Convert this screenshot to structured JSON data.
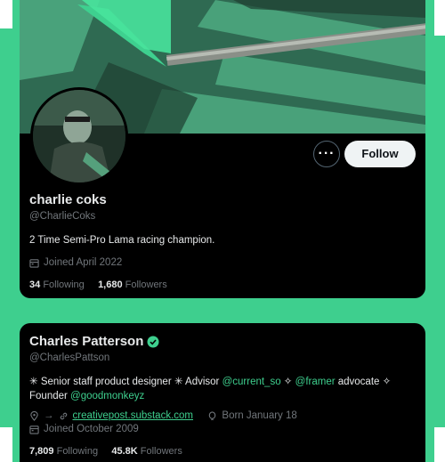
{
  "colors": {
    "accent": "#3ecf8e",
    "card_bg": "#000000",
    "muted": "#71767b",
    "text": "#e7e9ea"
  },
  "profile1": {
    "name": "charlie coks",
    "handle": "@CharlieCoks",
    "bio": "2 Time Semi-Pro Lama racing champion.",
    "joined": "Joined April 2022",
    "following_count": "34",
    "following_label": "Following",
    "followers_count": "1,680",
    "followers_label": "Followers",
    "more_label": "···",
    "follow_label": "Follow"
  },
  "profile2": {
    "name": "Charles Patterson",
    "handle": "@CharlesPattson",
    "bio_part1": "✳ Senior staff product designer ✳ Advisor ",
    "bio_link1": "@current_so",
    "bio_part2": " ✧ ",
    "bio_link2": "@framer",
    "bio_part3": " advocate ✧",
    "bio_part4": "Founder ",
    "bio_link3": "@goodmonkeyz",
    "arrow": "→",
    "website": "creativepost.substack.com",
    "born": "Born January 18",
    "joined": "Joined October 2009",
    "following_count": "7,809",
    "following_label": "Following",
    "followers_count": "45.8K",
    "followers_label": "Followers"
  }
}
